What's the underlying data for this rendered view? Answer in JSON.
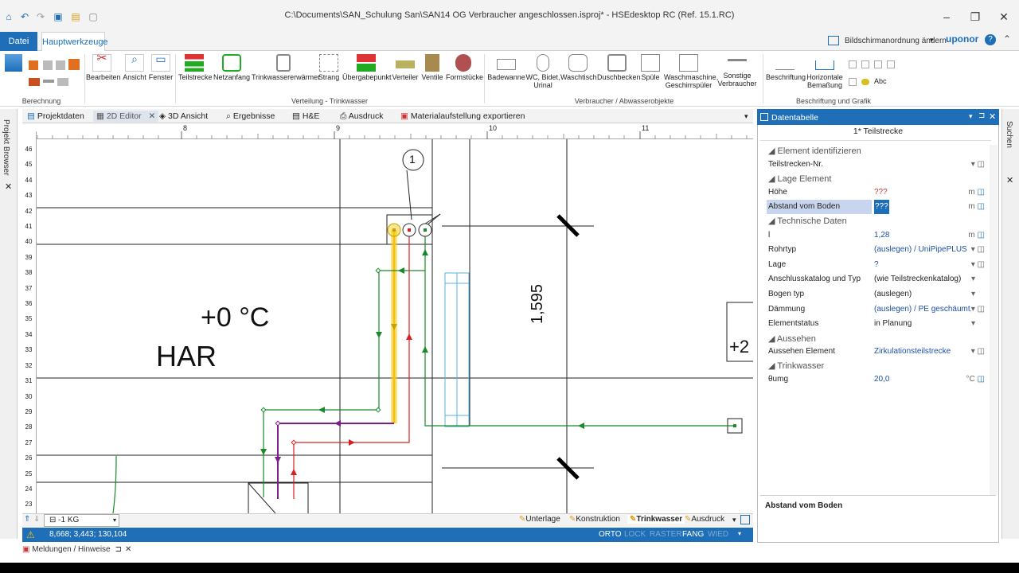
{
  "window": {
    "title": "C:\\Documents\\SAN_Schulung San\\SAN14 OG Verbraucher angeschlossen.isproj* - HSEdesktop RC (Ref. 15.1.RC)"
  },
  "ribbon_tabs": {
    "datei": "Datei",
    "haupt": "Hauptwerkzeuge",
    "screen_layout": "Bildschirmanordnung ändern",
    "brand": "uponor"
  },
  "ribbon": {
    "berechnung": "Berechnung",
    "bearbeiten": "Bearbeiten",
    "ansicht": "Ansicht",
    "fenster": "Fenster",
    "teilstrecke": "Teilstrecke",
    "netzanfang": "Netzanfang",
    "trinkwasserwaermer": "Trinkwassererwärmer",
    "strang": "Strang",
    "uebergabepunkt": "Übergabepunkt",
    "verteiler": "Verteiler",
    "ventile": "Ventile",
    "formstuecke": "Formstücke",
    "verteilung_group": "Verteilung - Trinkwasser",
    "badewanne": "Badewanne",
    "wc": "WC, Bidet, Urinal",
    "waschtisch": "Waschtisch",
    "duschbecken": "Duschbecken",
    "spuele": "Spüle",
    "waschmaschine": "Waschmaschine, Geschirrspüler",
    "sonstige": "Sonstige Verbraucher",
    "verbraucher_group": "Verbraucher / Abwasserobjekte",
    "beschriftung": "Beschriftung",
    "horiz_bemassung": "Horizontale Bemaßung",
    "abc": "Abc",
    "beschriftung_group": "Beschriftung und Grafik"
  },
  "doc_tabs": [
    "Projektdaten",
    "2D Editor",
    "3D Ansicht",
    "Ergebnisse",
    "H&E",
    "Ausdruck",
    "Materialaufstellung exportieren"
  ],
  "left_sidebar": "Projekt Browser",
  "right_sidebar": "Suchen",
  "ruler": {
    "top": [
      "8",
      "9",
      "10",
      "11"
    ],
    "left": [
      "46",
      "45",
      "44",
      "43",
      "42",
      "41",
      "40",
      "39",
      "38",
      "37",
      "36",
      "35",
      "34",
      "33",
      "32",
      "31",
      "30",
      "29",
      "28",
      "27",
      "26",
      "25",
      "24",
      "23"
    ],
    "corner": "19"
  },
  "canvas": {
    "temp_label": "+0 °C",
    "room_label": "HAR",
    "dimension": "1,595",
    "marker": "1",
    "room_right": "+2"
  },
  "bottom_tabs": [
    "Unterlage",
    "Konstruktion",
    "Trinkwasser",
    "Ausdruck"
  ],
  "level_select": "-1 KG",
  "status": {
    "coords": "8,668; 3,443; 130,104",
    "orto": "ORTO",
    "lock": "LOCK",
    "raster": "RASTER",
    "fang": "FANG",
    "wied": "WIED"
  },
  "messages": "Meldungen / Hinweise",
  "panel": {
    "title": "Datentabelle",
    "subtitle": "1* Teilstrecke",
    "sections": {
      "ident": "Element identifizieren",
      "lage": "Lage Element",
      "tech": "Technische Daten",
      "aussehen": "Aussehen",
      "trink": "Trinkwasser"
    },
    "rows": {
      "nr": {
        "label": "Teilstrecken-Nr.",
        "value": ""
      },
      "hoehe": {
        "label": "Höhe",
        "value": "???",
        "unit": "m"
      },
      "abstand": {
        "label": "Abstand vom Boden",
        "value": "???",
        "unit": "m"
      },
      "l": {
        "label": "l",
        "value": "1,28",
        "unit": "m"
      },
      "rohrtyp": {
        "label": "Rohrtyp",
        "value": "(auslegen) / UniPipePLUS"
      },
      "lage": {
        "label": "Lage",
        "value": "?"
      },
      "anschluss": {
        "label": "Anschlusskatalog und Typ",
        "value": "(wie Teilstreckenkatalog)"
      },
      "bogen": {
        "label": "Bogen typ",
        "value": "(auslegen)"
      },
      "daemmung": {
        "label": "Dämmung",
        "value": "(auslegen) / PE geschäumt, λ"
      },
      "status": {
        "label": "Elementstatus",
        "value": "in Planung"
      },
      "aussehen_el": {
        "label": "Aussehen Element",
        "value": "Zirkulationsteilstrecke"
      },
      "umg": {
        "label": "θumg",
        "value": "20,0",
        "unit": "°C"
      }
    },
    "description": "Abstand vom Boden"
  },
  "colors": {
    "accent": "#1e6fb8",
    "pipe_green": "#1a8a2a",
    "pipe_red": "#d92020",
    "pipe_purple": "#7a1f8a",
    "highlight": "#f5d020"
  }
}
